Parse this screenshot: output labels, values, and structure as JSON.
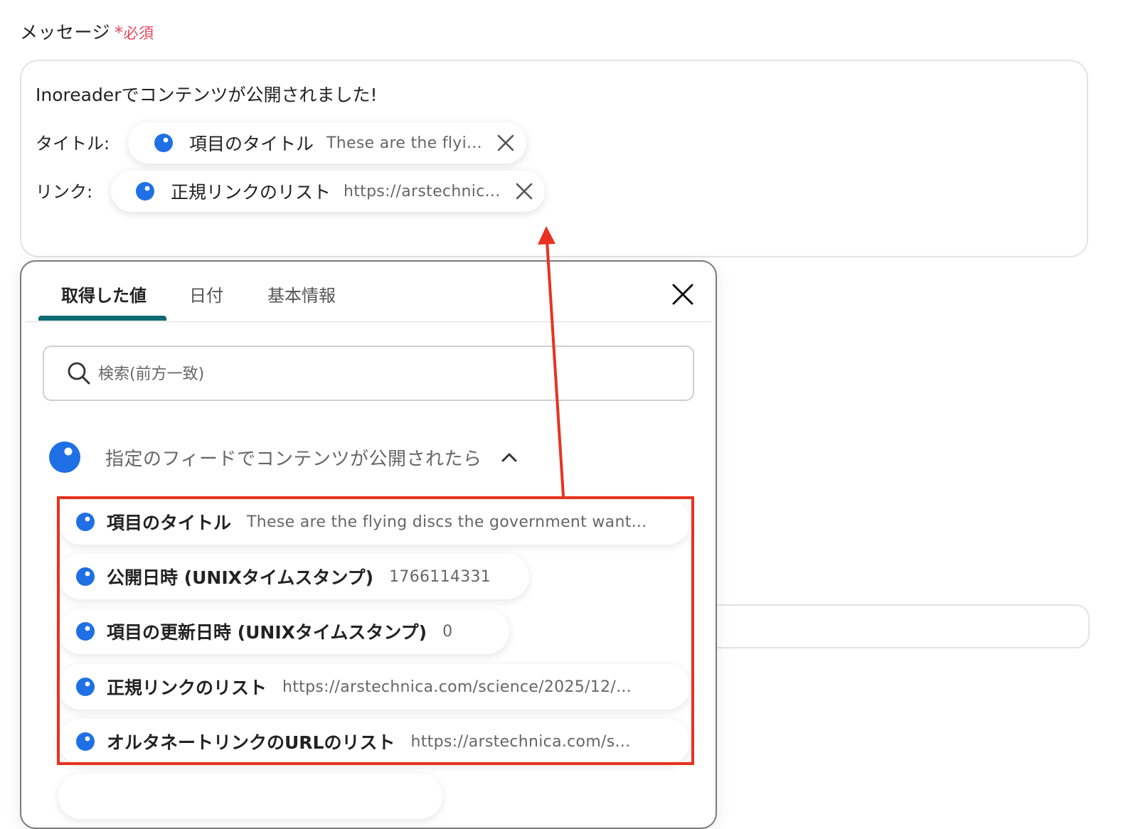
{
  "field": {
    "label": "メッセージ",
    "required_mark": "*",
    "required_text": "必須"
  },
  "message": {
    "line1": "Inoreaderでコンテンツが公開されました!",
    "title_label": "タイトル:",
    "link_label": "リンク:",
    "title_chip": {
      "name": "項目のタイトル",
      "value": "These are the flyi..."
    },
    "link_chip": {
      "name": "正規リンクのリスト",
      "value": "https://arstechnic..."
    }
  },
  "panel": {
    "tabs": [
      "取得した値",
      "日付",
      "基本情報"
    ],
    "active_tab": 0,
    "search_placeholder": "検索(前方一致)",
    "group_title": "指定のフィードでコンテンツが公開されたら",
    "items": [
      {
        "name": "項目のタイトル",
        "value": "These are the flying discs the government want..."
      },
      {
        "name": "公開日時 (UNIXタイムスタンプ)",
        "value": "1766114331"
      },
      {
        "name": "項目の更新日時 (UNIXタイムスタンプ)",
        "value": "0"
      },
      {
        "name": "正規リンクのリスト",
        "value": "https://arstechnica.com/science/2025/12/..."
      },
      {
        "name": "オルタネートリンクのURLのリスト",
        "value": "https://arstechnica.com/s..."
      }
    ]
  },
  "icons": {
    "chip_dot": "blue-dot-icon",
    "remove": "close-icon",
    "search": "search-icon",
    "collapse": "chevron-up-icon"
  },
  "colors": {
    "accent_blue": "#1f6fe5",
    "required_red": "#e8455a",
    "tab_underline": "#0e6a73",
    "annotation_red": "#e8321f"
  }
}
